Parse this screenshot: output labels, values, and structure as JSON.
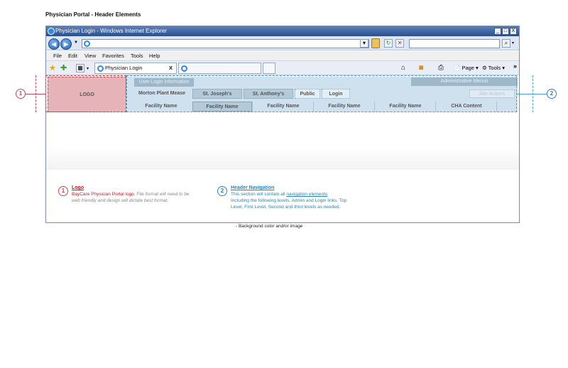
{
  "page_title": "Physician Portal - Header Elements",
  "browser": {
    "window_title": "Physician Login - Windows Internet Explorer",
    "window_buttons": [
      "_",
      "□",
      "X"
    ],
    "menu": [
      "File",
      "Edit",
      "View",
      "Favorites",
      "Tools",
      "Help"
    ],
    "tab_label": "Physician Login",
    "tab_close": "X",
    "toolbar_page": "Page",
    "toolbar_tools": "Tools",
    "toolbar_more": "»"
  },
  "header": {
    "logo_label": "LOGO",
    "user_login": "User Login Information",
    "admin_menus": "Administrative Menus",
    "site_actions": "Site Actions",
    "level1": [
      "Morton Plant Mease",
      "St. Joseph's",
      "St. Anthony's",
      "Public",
      "Login"
    ],
    "level2": [
      "Facility Name",
      "Facility Name",
      "Facility Name",
      "Facility Name",
      "Facility Name",
      "CHA Content"
    ]
  },
  "callouts": {
    "one": "1",
    "two": "2"
  },
  "notes": {
    "logo": {
      "number": "1",
      "title": "Logo",
      "body_strong": "BayCare Physician Portal logo.",
      "body_rest": " File format will need to be web friendly and design will dictate best format."
    },
    "nav": {
      "number": "2",
      "title": "Header Navigation",
      "body_1": "This section will contain all ",
      "body_link": "navigation elements",
      "body_2": "Including the following levels. Admin and Login links. Top Level, First Level, Second and third levels as needed."
    },
    "background": "- Background color and/or image"
  }
}
